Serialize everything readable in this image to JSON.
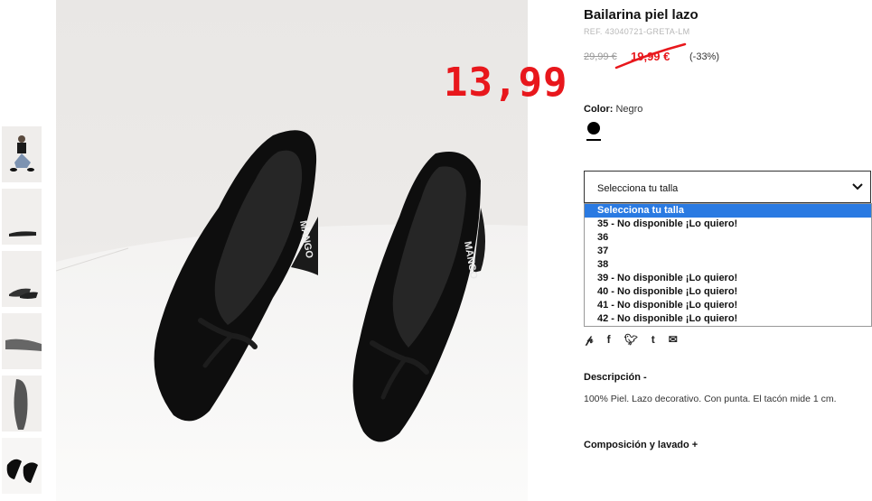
{
  "product": {
    "title": "Bailarina piel lazo",
    "reference": "REF. 43040721-GRETA-LM",
    "old_price": "29,99 €",
    "sale_price": "19,99 €",
    "discount": "(-33%)",
    "overlay_price": "13,99",
    "color_label": "Color:",
    "color_value": "Negro",
    "swatch_color": "#000000"
  },
  "size_select": {
    "placeholder": "Selecciona tu talla",
    "options": [
      "Selecciona tu talla",
      "35 - No disponible ¡Lo quiero!",
      "36",
      "37",
      "38",
      "39 - No disponible ¡Lo quiero!",
      "40 - No disponible ¡Lo quiero!",
      "41 - No disponible ¡Lo quiero!",
      "42 - No disponible ¡Lo quiero!"
    ]
  },
  "share_icons": [
    "pinterest-icon",
    "facebook-icon",
    "twitter-icon",
    "tumblr-icon",
    "email-icon"
  ],
  "description": {
    "heading": "Descripción -",
    "text": "100% Piel. Lazo decorativo. Con punta. El tacón mide 1 cm."
  },
  "composition": {
    "heading": "Composición y lavado +"
  },
  "colors": {
    "sale_red": "#e8171c",
    "highlight_blue": "#2a7ae2"
  }
}
